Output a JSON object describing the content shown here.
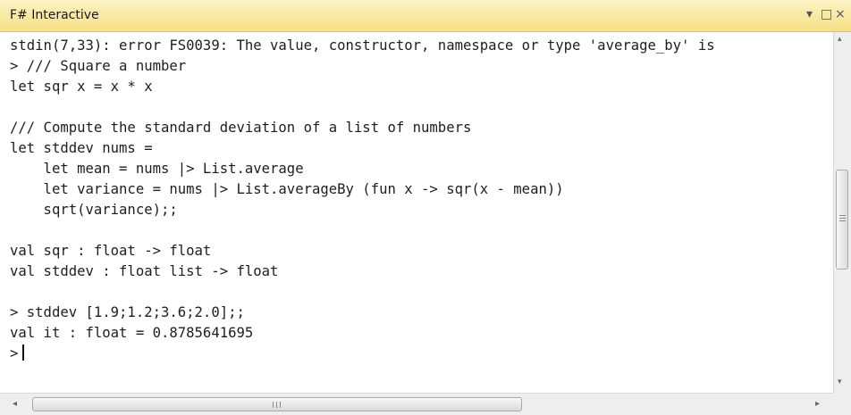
{
  "window": {
    "title": "F# Interactive",
    "controls": {
      "dropdown": "▾",
      "restore": "□",
      "close": "×"
    }
  },
  "console": {
    "lines": [
      "stdin(7,33): error FS0039: The value, constructor, namespace or type 'average_by' is",
      "> /// Square a number",
      "let sqr x = x * x",
      "",
      "/// Compute the standard deviation of a list of numbers",
      "let stddev nums =",
      "    let mean = nums |> List.average",
      "    let variance = nums |> List.averageBy (fun x -> sqr(x - mean))",
      "    sqrt(variance);;",
      "",
      "val sqr : float -> float",
      "val stddev : float list -> float",
      "",
      "> stddev [1.9;1.2;3.6;2.0];;",
      "val it : float = 0.8785641695",
      ">"
    ]
  },
  "scrollbars": {
    "vertical": {
      "up": "▴",
      "down": "▾"
    },
    "horizontal": {
      "left": "◂",
      "right": "▸",
      "grip": "III"
    }
  }
}
